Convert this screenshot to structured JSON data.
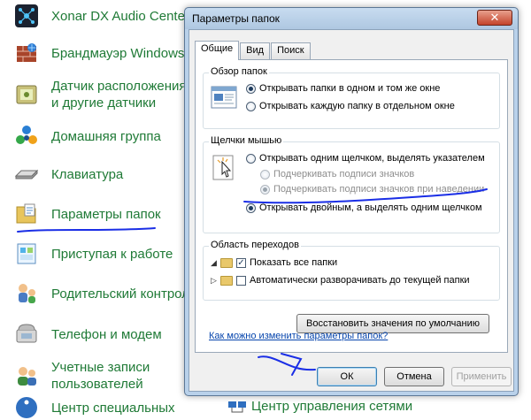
{
  "control_panel": {
    "items": [
      {
        "label": "Xonar DX Audio Center",
        "icon": "audio-center-icon"
      },
      {
        "label": "Брандмауэр Windows",
        "icon": "firewall-icon"
      },
      {
        "label": "Датчик расположения и другие датчики",
        "icon": "sensor-icon"
      },
      {
        "label": "Домашняя группа",
        "icon": "homegroup-icon"
      },
      {
        "label": "Клавиатура",
        "icon": "keyboard-icon"
      },
      {
        "label": "Параметры папок",
        "icon": "folder-options-icon"
      },
      {
        "label": "Приступая к работе",
        "icon": "getting-started-icon"
      },
      {
        "label": "Родительский контроль",
        "icon": "parental-control-icon"
      },
      {
        "label": "Телефон и модем",
        "icon": "phone-modem-icon"
      },
      {
        "label": "Учетные записи пользователей",
        "icon": "user-accounts-icon"
      },
      {
        "label": "Центр специальных",
        "icon": "accessibility-icon"
      }
    ],
    "right_item": {
      "label": "Центр управления сетями",
      "icon": "network-icon"
    }
  },
  "dialog": {
    "title": "Параметры папок",
    "close_label": "✕",
    "tabs": [
      "Общие",
      "Вид",
      "Поиск"
    ],
    "browse": {
      "group_label": "Обзор папок",
      "option_same_window": "Открывать папки в одном и том же окне",
      "option_new_window": "Открывать каждую папку в отдельном окне",
      "selected": "same_window"
    },
    "clicks": {
      "group_label": "Щелчки мышью",
      "option_single": "Открывать одним щелчком, выделять указателем",
      "sub_underline_always": "Подчеркивать подписи значков",
      "sub_underline_hover": "Подчеркивать подписи значков при наведении",
      "option_double": "Открывать двойным, а выделять одним щелчком",
      "selected": "double"
    },
    "nav": {
      "group_label": "Область переходов",
      "show_all_folders": "Показать все папки",
      "show_all_checked": true,
      "auto_expand": "Автоматически разворачивать до текущей папки",
      "auto_expand_checked": false
    },
    "restore_defaults": "Восстановить значения по умолчанию",
    "help_link": "Как можно изменить параметры папок?",
    "ok": "ОК",
    "cancel": "Отмена",
    "apply": "Применить"
  },
  "colors": {
    "label_green": "#1f7a36",
    "annotation_blue": "#1a2ee6",
    "dialog_frame": "#b9d1ea"
  }
}
